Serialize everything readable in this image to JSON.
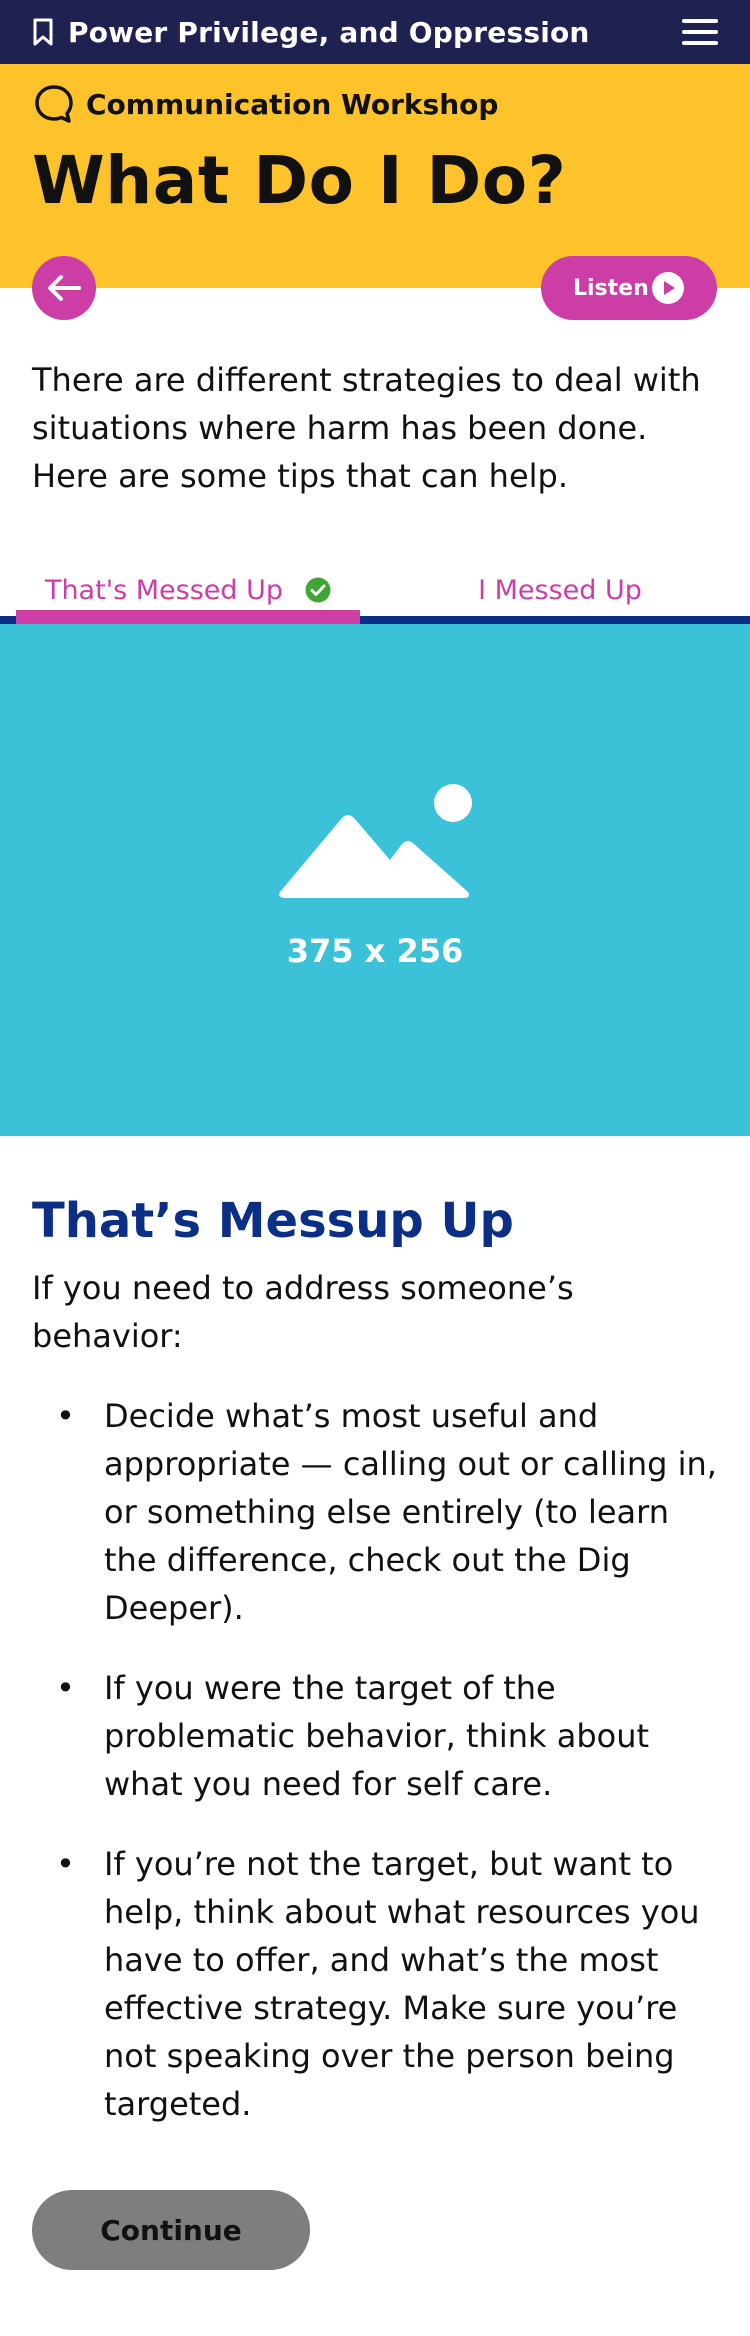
{
  "topbar": {
    "title": "Power Privilege, and Oppression",
    "bookmark_icon": "bookmark-icon",
    "menu_icon": "hamburger-menu-icon"
  },
  "hero": {
    "section_label": "Communication Workshop",
    "section_icon": "speech-bubble-icon",
    "heading": "What Do I Do?",
    "background_color": "#fec22b"
  },
  "actions": {
    "back_icon": "arrow-left-icon",
    "listen_label": "Listen",
    "listen_icon": "play-icon",
    "accent_color": "#cc3da6"
  },
  "intro": "There are different strategies to deal with situations where harm has been done. Here are some tips that can help.",
  "tabs": [
    {
      "label": "That's Messed Up",
      "active": true,
      "completed": true
    },
    {
      "label": "I Messed Up",
      "active": false,
      "completed": false
    }
  ],
  "image_placeholder": {
    "dimensions_label": "375 x 256",
    "icon": "image-mountain-icon",
    "background_color": "#3bc2d8"
  },
  "content": {
    "heading": "That’s Messup Up",
    "lead": "If you need to address someone’s behavior:",
    "bullets": [
      "Decide what’s most useful and appropriate — calling out or calling in, or something else entirely (to learn the difference, check out the Dig Deeper).",
      "If you were the target of the problematic behavior, think about what you need for self care.",
      "If you’re not the target, but want to help, think about what resources you have to offer, and what’s the most effective strategy. Make sure you’re not speaking over the person being targeted."
    ]
  },
  "continue_label": "Continue"
}
